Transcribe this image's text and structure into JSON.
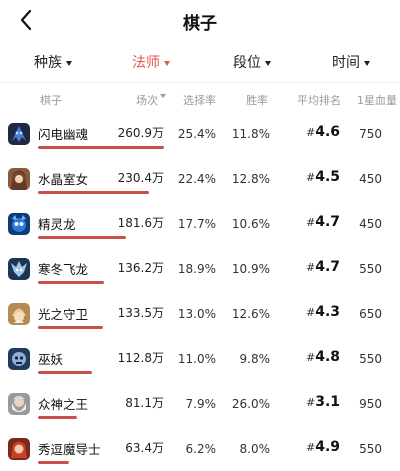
{
  "header": {
    "title": "棋子"
  },
  "filters": [
    {
      "label": "种族",
      "active": false
    },
    {
      "label": "法师",
      "active": true
    },
    {
      "label": "段位",
      "active": false
    },
    {
      "label": "时间",
      "active": false
    }
  ],
  "columns": {
    "piece": "棋子",
    "games": "场次",
    "pick_rate": "选择率",
    "win_rate": "胜率",
    "avg_rank": "平均排名",
    "one_star_hp": "1星血量"
  },
  "colors": {
    "accent": "#e0554f",
    "bar": "#c8504a"
  },
  "rows": [
    {
      "name": "闪电幽魂",
      "games": "260.9万",
      "games_share": 1.0,
      "pick_rate": "25.4%",
      "win_rate": "11.8%",
      "rank_prefix": "#",
      "avg_rank": "4.6",
      "hp": "750",
      "icon": "lightning-ghost-icon"
    },
    {
      "name": "水晶室女",
      "games": "230.4万",
      "games_share": 0.883,
      "pick_rate": "22.4%",
      "win_rate": "12.8%",
      "rank_prefix": "#",
      "avg_rank": "4.5",
      "hp": "450",
      "icon": "crystal-maiden-icon"
    },
    {
      "name": "精灵龙",
      "games": "181.6万",
      "games_share": 0.696,
      "pick_rate": "17.7%",
      "win_rate": "10.6%",
      "rank_prefix": "#",
      "avg_rank": "4.7",
      "hp": "450",
      "icon": "puck-dragon-icon"
    },
    {
      "name": "寒冬飞龙",
      "games": "136.2万",
      "games_share": 0.522,
      "pick_rate": "18.9%",
      "win_rate": "10.9%",
      "rank_prefix": "#",
      "avg_rank": "4.7",
      "hp": "550",
      "icon": "winter-wyvern-icon"
    },
    {
      "name": "光之守卫",
      "games": "133.5万",
      "games_share": 0.512,
      "pick_rate": "13.0%",
      "win_rate": "12.6%",
      "rank_prefix": "#",
      "avg_rank": "4.3",
      "hp": "650",
      "icon": "keeper-of-light-icon"
    },
    {
      "name": "巫妖",
      "games": "112.8万",
      "games_share": 0.432,
      "pick_rate": "11.0%",
      "win_rate": "9.8%",
      "rank_prefix": "#",
      "avg_rank": "4.8",
      "hp": "550",
      "icon": "lich-icon"
    },
    {
      "name": "众神之王",
      "games": "81.1万",
      "games_share": 0.311,
      "pick_rate": "7.9%",
      "win_rate": "26.0%",
      "rank_prefix": "#",
      "avg_rank": "3.1",
      "hp": "950",
      "icon": "zeus-icon"
    },
    {
      "name": "秀逗魔导士",
      "games": "63.4万",
      "games_share": 0.243,
      "pick_rate": "6.2%",
      "win_rate": "8.0%",
      "rank_prefix": "#",
      "avg_rank": "4.9",
      "hp": "550",
      "icon": "lina-icon"
    }
  ]
}
